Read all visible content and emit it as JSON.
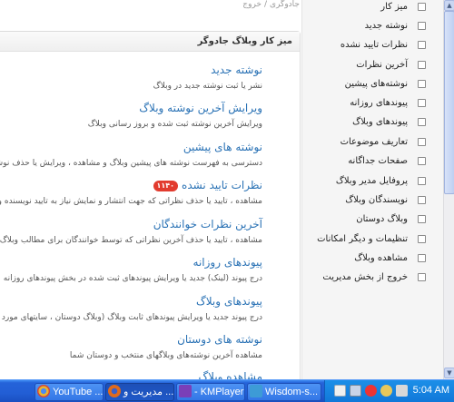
{
  "breadcrumb": [
    "جادوگری",
    "خروج"
  ],
  "box_title": "میز کار وبلاگ جادوگر",
  "entries": [
    {
      "title": "نوشته جدید",
      "desc": "نشر یا ثبت نوشته جدید در وبلاگ"
    },
    {
      "title": "ویرایش آخرین نوشته وبلاگ",
      "desc": "ویرایش آخرین نوشته ثبت شده و بروز رسانی وبلاگ"
    },
    {
      "title": "نوشته های پیشین",
      "desc": "دسترسی به فهرست نوشته های پیشین وبلاگ و مشاهده ، ویرایش یا حذف نوشته ها"
    },
    {
      "title": "نظرات تایید نشده",
      "badge": "۱۱۴۰",
      "desc": "مشاهده ، تایید یا حذف نظراتی که جهت انتشار و نمایش نیاز به تایید نویسنده وبلاگ دارند"
    },
    {
      "title": "آخرین نظرات خوانندگان",
      "desc": "مشاهده ، تایید یا حذف آخرین نظراتی که توسط خوانندگان برای مطالب وبلاگ نوشته شده اند"
    },
    {
      "title": "پیوندهای روزانه",
      "desc": "درج پیوند (لینک) جدید یا ویرایش پیوندهای ثبت شده در بخش پیوندهای روزانه"
    },
    {
      "title": "پیوندهای وبلاگ",
      "desc": "درج پیوند جدید یا ویرایش پیوندهای ثابت وبلاگ (وبلاگ دوستان ، سایتهای مورد علاقه و ...)"
    },
    {
      "title": "نوشته های دوستان",
      "desc": "مشاهده آخرین نوشته‌های وبلاگهای منتخب و دوستان شما"
    },
    {
      "title": "مشاهده وبلاگ",
      "desc": ""
    }
  ],
  "sidebar": {
    "items": [
      {
        "label": "میز کار"
      },
      {
        "label": "نوشته جدید"
      },
      {
        "label": "نظرات تایید نشده"
      },
      {
        "label": "آخرین نظرات"
      },
      {
        "label": "نوشته‌های پیشین"
      },
      {
        "label": "پیوندهای روزانه"
      },
      {
        "label": "پیوندهای وبلاگ"
      },
      {
        "label": "تعاریف موضوعات"
      },
      {
        "label": "صفحات جداگانه"
      },
      {
        "label": "پروفایل مدیر وبلاگ"
      },
      {
        "label": "نویسندگان وبلاگ"
      },
      {
        "label": "وبلاگ دوستان"
      },
      {
        "label": "تنظیمات و دیگر امکانات"
      },
      {
        "label": "مشاهده وبلاگ"
      },
      {
        "label": "خروج از بخش مدیریت"
      }
    ]
  },
  "taskbar": {
    "buttons": [
      {
        "label": "YouTube ...",
        "icon": "chrome-icon",
        "color": "#e8b431",
        "active": false
      },
      {
        "label": "مدیریت و ...",
        "icon": "firefox-icon",
        "color": "#e06a1c",
        "active": true
      },
      {
        "label": "- KMPlayer",
        "icon": "kmplayer-icon",
        "color": "#7a3fb8",
        "active": false
      },
      {
        "label": "Wisdom-s...",
        "icon": "paint-icon",
        "color": "#3d9bd6",
        "active": false
      }
    ],
    "clock": "5:04 AM"
  },
  "colors": {
    "link": "#2a72b5",
    "badge": "#e23b2e",
    "taskbar": "#225ed5",
    "tray": "#1178d9"
  }
}
